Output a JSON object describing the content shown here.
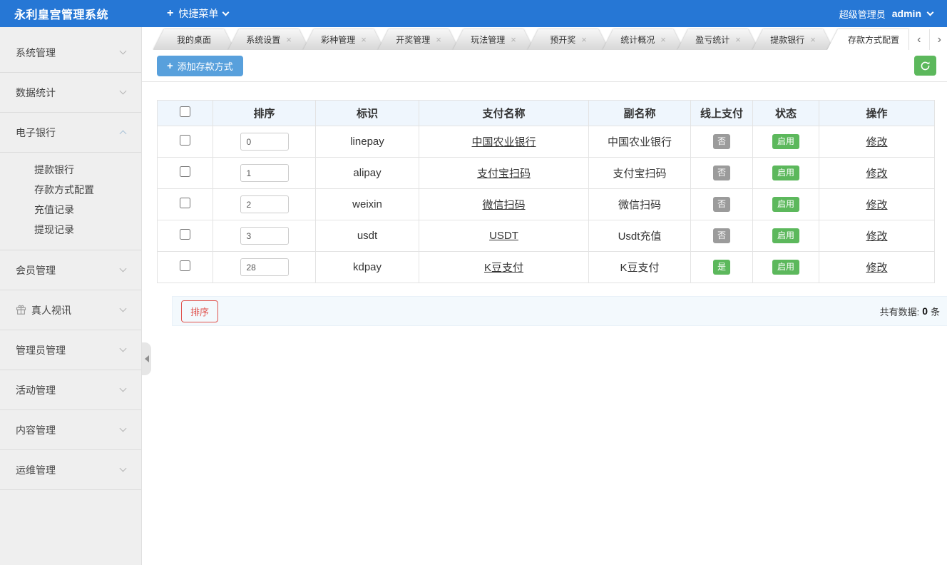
{
  "topbar": {
    "title": "永利皇宫管理系统",
    "quick_menu_label": "快捷菜单",
    "role": "超级管理员",
    "username": "admin"
  },
  "sidebar": {
    "items": [
      {
        "label": "系统管理"
      },
      {
        "label": "数据统计"
      },
      {
        "label": "电子银行",
        "expanded": true
      },
      {
        "label": "会员管理"
      },
      {
        "label": "真人视讯",
        "icon": "gift-icon"
      },
      {
        "label": "管理员管理"
      },
      {
        "label": "活动管理"
      },
      {
        "label": "内容管理"
      },
      {
        "label": "运维管理"
      }
    ],
    "submenu": [
      {
        "label": "提款银行"
      },
      {
        "label": "存款方式配置",
        "active": true
      },
      {
        "label": "充值记录"
      },
      {
        "label": "提现记录"
      }
    ]
  },
  "tabs": {
    "items": [
      {
        "label": "我的桌面",
        "closable": false
      },
      {
        "label": "系统设置",
        "closable": true
      },
      {
        "label": "彩种管理",
        "closable": true
      },
      {
        "label": "开奖管理",
        "closable": true
      },
      {
        "label": "玩法管理",
        "closable": true
      },
      {
        "label": "预开奖",
        "closable": true
      },
      {
        "label": "统计概况",
        "closable": true
      },
      {
        "label": "盈亏统计",
        "closable": true
      },
      {
        "label": "提款银行",
        "closable": true
      },
      {
        "label": "存款方式配置",
        "closable": false,
        "active": true
      }
    ]
  },
  "toolbar": {
    "add_button": "添加存款方式"
  },
  "table": {
    "headers": [
      "排序",
      "标识",
      "支付名称",
      "副名称",
      "线上支付",
      "状态",
      "操作"
    ],
    "rows": [
      {
        "sort": "0",
        "code": "linepay",
        "pay_name": "中国农业银行",
        "sub_name": "中国农业银行",
        "online": "否",
        "status": "启用",
        "action": "修改"
      },
      {
        "sort": "1",
        "code": "alipay",
        "pay_name": "支付宝扫码",
        "sub_name": "支付宝扫码",
        "online": "否",
        "status": "启用",
        "action": "修改"
      },
      {
        "sort": "2",
        "code": "weixin",
        "pay_name": "微信扫码",
        "sub_name": "微信扫码",
        "online": "否",
        "status": "启用",
        "action": "修改"
      },
      {
        "sort": "3",
        "code": "usdt",
        "pay_name": "USDT",
        "sub_name": "Usdt充值",
        "online": "否",
        "status": "启用",
        "action": "修改"
      },
      {
        "sort": "28",
        "code": "kdpay",
        "pay_name": "K豆支付",
        "sub_name": "K豆支付",
        "online": "是",
        "status": "启用",
        "action": "修改"
      }
    ]
  },
  "footer": {
    "sort_button": "排序",
    "total_label": "共有数据:",
    "total_count": "0",
    "total_unit": "条"
  },
  "icons": {
    "plus": "+",
    "close": "×",
    "arrow_left": "‹",
    "arrow_right": "›"
  },
  "colors": {
    "topbar_blue": "#2677D5",
    "button_blue": "#58A0DC",
    "green": "#5CB85C",
    "badge_gray": "#9B9B9B",
    "red": "#E0524D",
    "table_header_bg": "#EFF6FD",
    "footer_bg": "#F3F9FD"
  }
}
